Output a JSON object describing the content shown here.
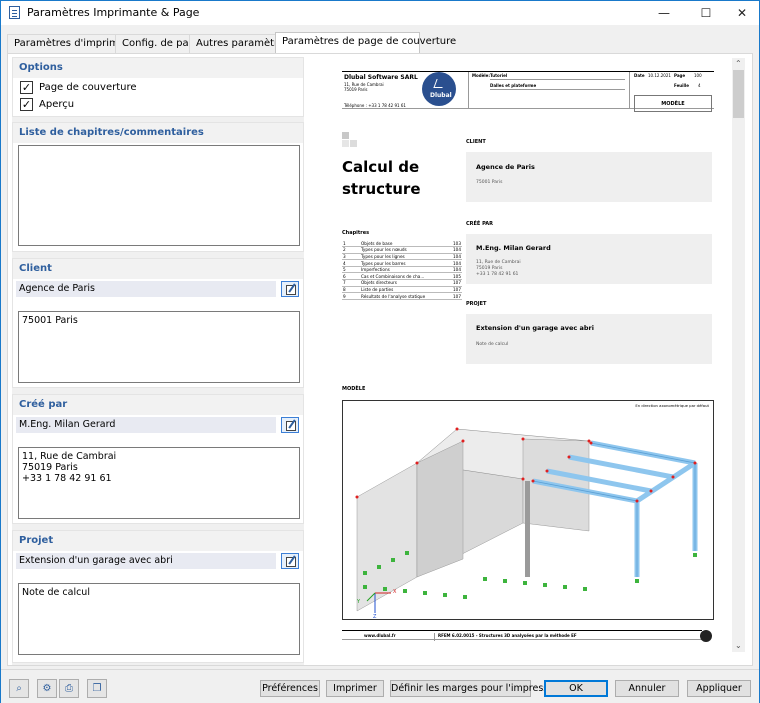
{
  "window": {
    "title": "Paramètres Imprimante & Page",
    "minimize": "—",
    "maximize": "☐",
    "close": "✕"
  },
  "tabs": [
    {
      "label": "Paramètres d'imprimante",
      "active": false
    },
    {
      "label": "Config. de page",
      "active": false
    },
    {
      "label": "Autres paramètres",
      "active": false
    },
    {
      "label": "Paramètres de page de couverture",
      "active": true
    }
  ],
  "options": {
    "heading": "Options",
    "cover_page": {
      "label": "Page de couverture",
      "checked": true
    },
    "preview": {
      "label": "Aperçu",
      "checked": true
    }
  },
  "chapters_section": {
    "heading": "Liste de chapitres/commentaires",
    "text": ""
  },
  "client": {
    "heading": "Client",
    "name": "Agence de Paris",
    "details": "75001 Paris"
  },
  "created_by": {
    "heading": "Créé par",
    "name": "M.Eng. Milan Gerard",
    "details": "11, Rue de Cambrai\n75019 Paris\n+33 1 78 42 91 61"
  },
  "project": {
    "heading": "Projet",
    "name": "Extension d'un garage avec abri",
    "details": "Note de calcul"
  },
  "preview": {
    "company": "Dlubal Software SARL",
    "company_addr1": "11, Rue de Cambrai",
    "company_addr2": "75019 Paris",
    "phone": "Téléphone : +33 1 78 42 91 61",
    "logo_text": "Dlubal",
    "model_label": "Modèle:",
    "model_value": "Tutoriel",
    "model_value2": "Dalles et plateforme",
    "date_label": "Date",
    "date_value": "10.12.2021",
    "page_label": "Page",
    "page_value": "100",
    "sheet_label": "Feuille",
    "sheet_value": "4",
    "model_box": "MODÈLE",
    "doc_title_1": "Calcul de",
    "doc_title_2": "structure",
    "client_label": "CLIENT",
    "client_name": "Agence de Paris",
    "client_addr": "75001 Paris",
    "created_label": "CRÉÉ PAR",
    "created_name": "M.Eng. Milan Gerard",
    "created_addr1": "11, Rue de Cambrai",
    "created_addr2": "75019 Paris",
    "created_addr3": "+33 1 78 42 91 61",
    "project_label": "PROJET",
    "project_name": "Extension d'un garage avec abri",
    "project_note": "Note de calcul",
    "chapters_title": "Chapitres",
    "chapters": [
      {
        "n": "1",
        "t": "Objets de base",
        "p": "103"
      },
      {
        "n": "2",
        "t": "Types pour les nœuds",
        "p": "104"
      },
      {
        "n": "3",
        "t": "Types pour les lignes",
        "p": "104"
      },
      {
        "n": "4",
        "t": "Types pour les barres",
        "p": "104"
      },
      {
        "n": "5",
        "t": "Imperfections",
        "p": "104"
      },
      {
        "n": "6",
        "t": "Cas et Combinaisons de cha...",
        "p": "105"
      },
      {
        "n": "7",
        "t": "Objets directeurs",
        "p": "107"
      },
      {
        "n": "8",
        "t": "Liste de parties",
        "p": "107"
      },
      {
        "n": "9",
        "t": "Résultats de l'analyse statique",
        "p": "107"
      }
    ],
    "model_section": "MODÈLE",
    "model_caption": "En direction axonométrique par défaut",
    "axis_x": "X",
    "axis_y": "Y",
    "axis_z": "Z",
    "footer_web": "www.dlubal.fr",
    "footer_sw": "RFEM 6.02.0015 - Structures 3D analysées par la méthode EF"
  },
  "toolbar_icons": [
    "search-icon",
    "settings-icon",
    "print-setup-icon",
    "copy-icon"
  ],
  "buttons": {
    "preferences": "Préférences",
    "print": "Imprimer",
    "margins": "Définir les marges pour l'impression",
    "ok": "OK",
    "cancel": "Annuler",
    "apply": "Appliquer"
  },
  "colors": {
    "accent": "#2f5f9e",
    "title_bar": "#ffffff",
    "border_focus": "#0078d7",
    "model_blue": "#a9d3f2"
  }
}
